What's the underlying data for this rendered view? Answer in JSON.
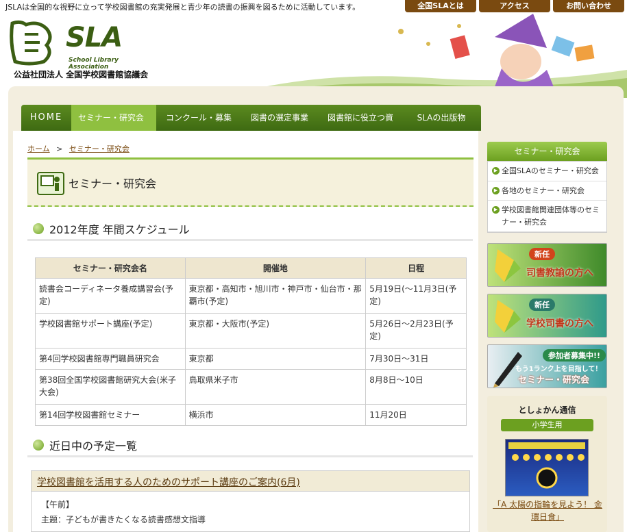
{
  "header": {
    "tagline": "JSLAは全国的な視野に立って学校図書館の充実発展と青少年の読書の振興を図るために活動しています。",
    "top_links": [
      "全国SLAとは",
      "アクセス",
      "お問い合わせ"
    ],
    "logo_text": "SLA",
    "logo_sub": "School Library Association",
    "org_name": "公益社団法人 全国学校図書館協議会"
  },
  "nav": {
    "items": [
      "HOME",
      "セミナー・研究会",
      "コンクール・募集",
      "図書の選定事業",
      "図書館に役立つ資料",
      "SLAの出版物"
    ],
    "active_index": 1
  },
  "breadcrumb": {
    "home": "ホーム",
    "sep": ">",
    "current": "セミナー・研究会"
  },
  "page_title": "セミナー・研究会",
  "schedule": {
    "heading": "2012年度 年間スケジュール",
    "columns": [
      "セミナー・研究会名",
      "開催地",
      "日程"
    ],
    "rows": [
      [
        "読書会コーディネータ養成講習会(予定)",
        "東京都・高知市・旭川市・神戸市・仙台市・那覇市(予定)",
        "5月19日(～11月3日(予定)"
      ],
      [
        "学校図書館サポート講座(予定)",
        "東京都・大阪市(予定)",
        "5月26日～2月23日(予定)"
      ],
      [
        "第4回学校図書館専門職員研究会",
        "東京都",
        "7月30日～31日"
      ],
      [
        "第38回全国学校図書館研究大会(米子大会)",
        "鳥取県米子市",
        "8月8日～10日"
      ],
      [
        "第14回学校図書館セミナー",
        "横浜市",
        "11月20日"
      ]
    ]
  },
  "upcoming": {
    "heading": "近日中の予定一覧",
    "item_title": "学校図書館を活用する人のためのサポート講座のご案内(6月)",
    "line1": "【午前】",
    "line2": "主題：子どもが書きたくなる読書感想文指導"
  },
  "sidebar": {
    "heading": "セミナー・研究会",
    "items": [
      "全国SLAのセミナー・研究会",
      "各地のセミナー・研究会",
      "学校図書館関連団体等のセミナー・研究会"
    ],
    "banners": [
      {
        "tag": "新任",
        "text": "司書教諭の方へ"
      },
      {
        "tag": "新任",
        "text": "学校司書の方へ"
      },
      {
        "tag": "参加者募集中!!",
        "text": "セミナー・研究会",
        "sub": "もう1ランク上を目指して！"
      }
    ],
    "tsushin": {
      "title": "としょかん通信",
      "pill": "小学生用",
      "caption": "「A 太陽の指輪を見よう！ 金環日食」"
    }
  },
  "colors": {
    "green": "#6ca020",
    "dark_green": "#3e6a12",
    "brown": "#7a4a10",
    "beige": "#f3eedf"
  }
}
